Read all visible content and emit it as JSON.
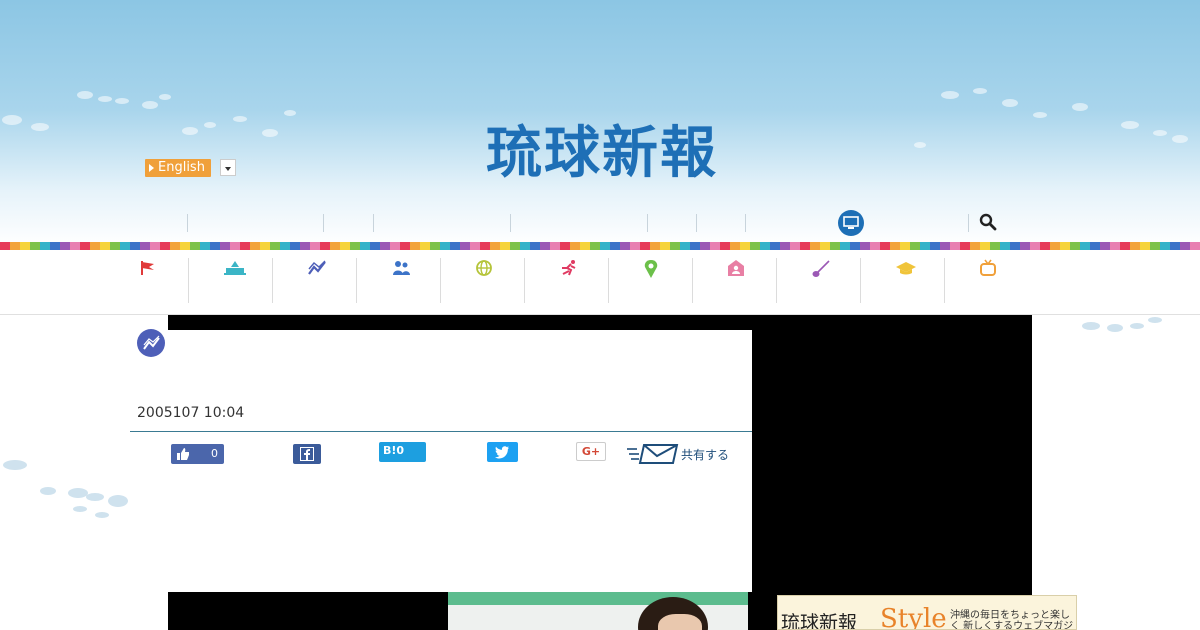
{
  "header": {
    "logo_text": "琉球新報",
    "language_button": "English"
  },
  "category_icons": [
    {
      "icon": "flag-icon",
      "color": "#e03a3a"
    },
    {
      "icon": "government-building-icon",
      "color": "#3bb5c6"
    },
    {
      "icon": "economy-chart-icon",
      "color": "#4e5fb8"
    },
    {
      "icon": "people-icon",
      "color": "#3c73c8"
    },
    {
      "icon": "globe-icon",
      "color": "#b5c43a"
    },
    {
      "icon": "runner-icon",
      "color": "#e03a62"
    },
    {
      "icon": "map-pin-icon",
      "color": "#6cc04a"
    },
    {
      "icon": "community-house-icon",
      "color": "#e87fa4"
    },
    {
      "icon": "sanshin-instrument-icon",
      "color": "#9b58b5"
    },
    {
      "icon": "graduation-cap-icon",
      "color": "#f0c43a"
    },
    {
      "icon": "tv-icon",
      "color": "#f0a03a"
    }
  ],
  "article": {
    "date": "2005107 10:04",
    "like_count": "0",
    "hatena_label": "B!0",
    "google_label": "G+",
    "share_label": "共有する"
  },
  "ads": {
    "style_name": "琉球新報",
    "style_word": "Style",
    "style_desc": "沖縄の毎日をちょっと楽しく 新しくするウェブマガジン"
  },
  "colors": {
    "brand_blue": "#1e6fb6",
    "accent_orange": "#f0a03a"
  }
}
